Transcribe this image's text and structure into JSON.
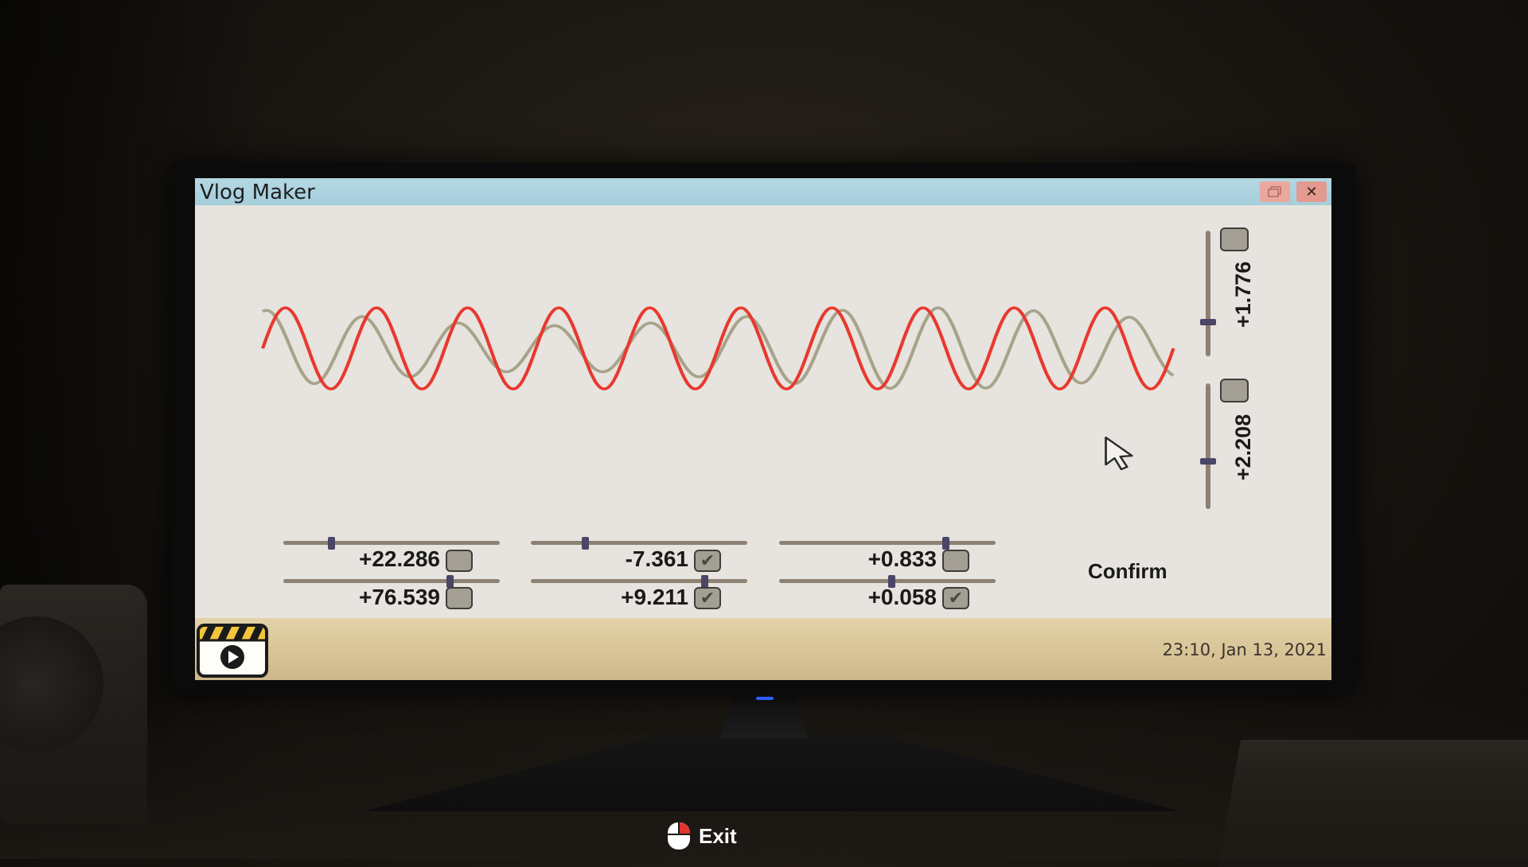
{
  "window": {
    "title": "Vlog Maker",
    "restore_icon": "restore-icon",
    "close_label": "✕"
  },
  "wave": {
    "target_color": "#e8392f",
    "signal_color": "#a6a38a",
    "target_cycles": 10,
    "signal_description_icon": "cursor-icon"
  },
  "vertical_controls": [
    {
      "value": "+1.776",
      "checked": false,
      "level": 0.27
    },
    {
      "value": "+2.208",
      "checked": false,
      "level": 0.38
    }
  ],
  "horizontal_controls": [
    {
      "value": "+22.286",
      "checked": false,
      "level": 0.22
    },
    {
      "value": "+76.539",
      "checked": false,
      "level": 0.77
    },
    {
      "value": "-7.361",
      "checked": true,
      "level": 0.25
    },
    {
      "value": "+9.211",
      "checked": true,
      "level": 0.8
    },
    {
      "value": "+0.833",
      "checked": false,
      "level": 0.77
    },
    {
      "value": "+0.058",
      "checked": true,
      "level": 0.52
    }
  ],
  "confirm_label": "Confirm",
  "taskbar": {
    "app_icon": "clapperboard-play-icon",
    "clock": "23:10, Jan 13, 2021"
  },
  "exit": {
    "icon": "mouse-right-click-icon",
    "label": "Exit"
  }
}
